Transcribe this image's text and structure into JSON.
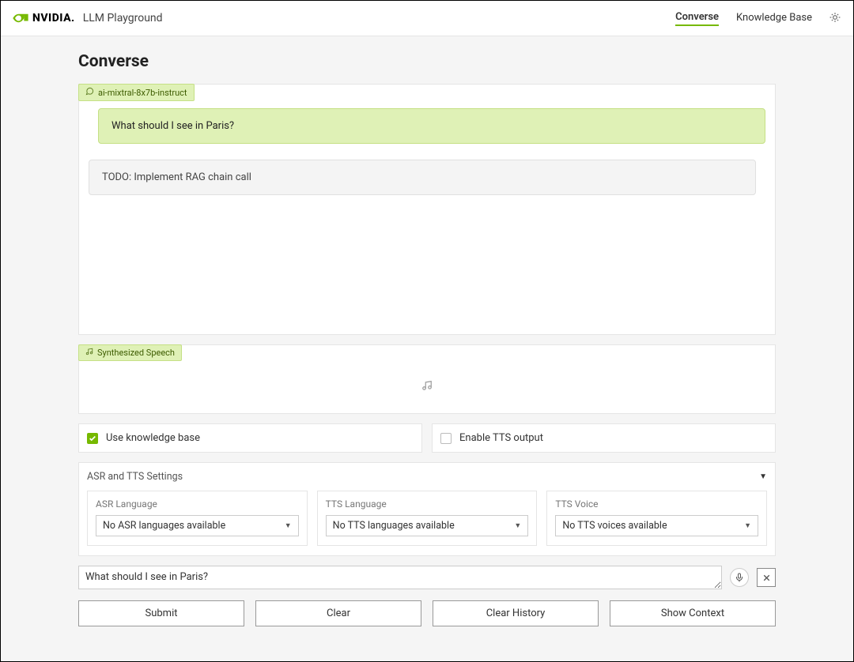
{
  "header": {
    "logo_text": "NVIDIA.",
    "app_title": "LLM Playground",
    "nav": {
      "converse": "Converse",
      "kb": "Knowledge Base"
    }
  },
  "page": {
    "title": "Converse"
  },
  "chat": {
    "model_tag": "ai-mixtral-8x7b-instruct",
    "messages": {
      "user": "What should I see in Paris?",
      "bot": "TODO: Implement RAG chain call"
    }
  },
  "speech": {
    "tag": "Synthesized Speech"
  },
  "checkboxes": {
    "kb": {
      "label": "Use knowledge base",
      "checked": true
    },
    "tts": {
      "label": "Enable TTS output",
      "checked": false
    }
  },
  "settings": {
    "title": "ASR and TTS Settings",
    "asr": {
      "label": "ASR Language",
      "value": "No ASR languages available"
    },
    "tts_lang": {
      "label": "TTS Language",
      "value": "No TTS languages available"
    },
    "tts_voice": {
      "label": "TTS Voice",
      "value": "No TTS voices available"
    }
  },
  "input": {
    "value": "What should I see in Paris?"
  },
  "buttons": {
    "submit": "Submit",
    "clear": "Clear",
    "clear_history": "Clear History",
    "show_context": "Show Context"
  }
}
